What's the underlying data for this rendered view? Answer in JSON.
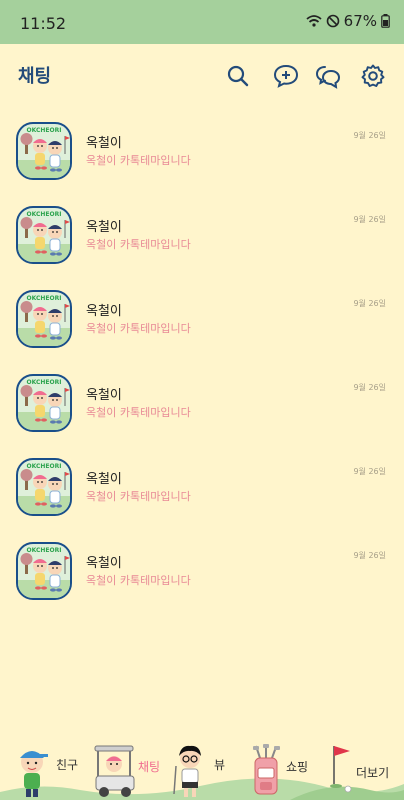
{
  "status_bar": {
    "time": "11:52",
    "battery": "67%"
  },
  "header": {
    "title": "채팅",
    "icons": [
      "search-icon",
      "new-chat-icon",
      "open-chat-icon",
      "settings-icon"
    ]
  },
  "chats": [
    {
      "name": "옥철이",
      "message": "옥철이 카톡테마입니다",
      "time": "9월 26일",
      "avatar_text": "OKCHEORI"
    },
    {
      "name": "옥철이",
      "message": "옥철이 카톡테마입니다",
      "time": "9월 26일",
      "avatar_text": "OKCHEORI"
    },
    {
      "name": "옥철이",
      "message": "옥철이 카톡테마입니다",
      "time": "9월 26일",
      "avatar_text": "OKCHEORI"
    },
    {
      "name": "옥철이",
      "message": "옥철이 카톡테마입니다",
      "time": "9월 26일",
      "avatar_text": "OKCHEORI"
    },
    {
      "name": "옥철이",
      "message": "옥철이 카톡테마입니다",
      "time": "9월 26일",
      "avatar_text": "OKCHEORI"
    },
    {
      "name": "옥철이",
      "message": "옥철이 카톡테마입니다",
      "time": "9월 26일",
      "avatar_text": "OKCHEORI"
    }
  ],
  "tabs": [
    {
      "label": "친구",
      "icon": "friends-character-icon",
      "active": false
    },
    {
      "label": "채팅",
      "icon": "golf-cart-icon",
      "active": true
    },
    {
      "label": "뷰",
      "icon": "golfer-character-icon",
      "active": false
    },
    {
      "label": "쇼핑",
      "icon": "golf-bag-icon",
      "active": false
    },
    {
      "label": "더보기",
      "icon": "golf-flag-icon",
      "active": false
    }
  ],
  "colors": {
    "status_bar": "#a5d09c",
    "background": "#fff5cc",
    "title": "#234b7a",
    "message": "#e88a96",
    "active_tab": "#f06c90"
  }
}
